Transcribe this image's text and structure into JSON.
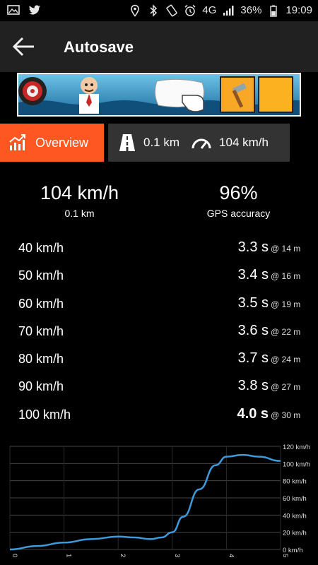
{
  "status_bar": {
    "network": "4G",
    "battery": "36%",
    "time": "19:09",
    "icons": [
      "image-icon",
      "twitter-icon",
      "location-icon",
      "bluetooth-icon",
      "rotate-icon",
      "alarm-icon",
      "signal-icon",
      "battery-icon"
    ]
  },
  "header": {
    "title": "Autosave",
    "back_icon": "arrow-left-icon"
  },
  "tabs": {
    "overview_label": "Overview",
    "distance": "0.1 km",
    "max_speed": "104 km/h"
  },
  "summary": {
    "max_speed": "104 km/h",
    "distance": "0.1 km",
    "accuracy": "96%",
    "accuracy_label": "GPS accuracy"
  },
  "rows": [
    {
      "speed": "40 km/h",
      "time": "3.3 s",
      "dist": "@ 14 m",
      "bold": false
    },
    {
      "speed": "50 km/h",
      "time": "3.4 s",
      "dist": "@ 16 m",
      "bold": false
    },
    {
      "speed": "60 km/h",
      "time": "3.5 s",
      "dist": "@ 19 m",
      "bold": false
    },
    {
      "speed": "70 km/h",
      "time": "3.6 s",
      "dist": "@ 22 m",
      "bold": false
    },
    {
      "speed": "80 km/h",
      "time": "3.7 s",
      "dist": "@ 24 m",
      "bold": false
    },
    {
      "speed": "90 km/h",
      "time": "3.8 s",
      "dist": "@ 27 m",
      "bold": false
    },
    {
      "speed": "100 km/h",
      "time": "4.0 s",
      "dist": "@ 30 m",
      "bold": true
    }
  ],
  "colors": {
    "accent": "#ff5722",
    "line": "#3d9bdc",
    "appbar": "#212121",
    "tab": "#333333"
  },
  "chart_data": {
    "type": "line",
    "x": [
      0,
      0.5,
      1,
      1.5,
      2,
      2.3,
      2.6,
      2.8,
      3.0,
      3.2,
      3.5,
      3.8,
      4.0,
      4.3,
      4.6,
      5.0
    ],
    "series": [
      {
        "values": [
          0,
          4,
          8,
          12,
          15,
          14,
          12,
          14,
          20,
          38,
          70,
          98,
          108,
          110,
          108,
          103
        ]
      }
    ],
    "ytick_labels": [
      "0 km/h",
      "20 km/h",
      "40 km/h",
      "60 km/h",
      "80 km/h",
      "100 km/h",
      "120 km/h"
    ],
    "yticks": [
      0,
      20,
      40,
      60,
      80,
      100,
      120
    ],
    "xtick_labels": [
      "0",
      "1",
      "2",
      "3",
      "4",
      "5"
    ],
    "xticks": [
      0,
      1,
      2,
      3,
      4,
      5
    ],
    "xlim": [
      0,
      5
    ],
    "ylim": [
      0,
      120
    ],
    "grid": true
  }
}
